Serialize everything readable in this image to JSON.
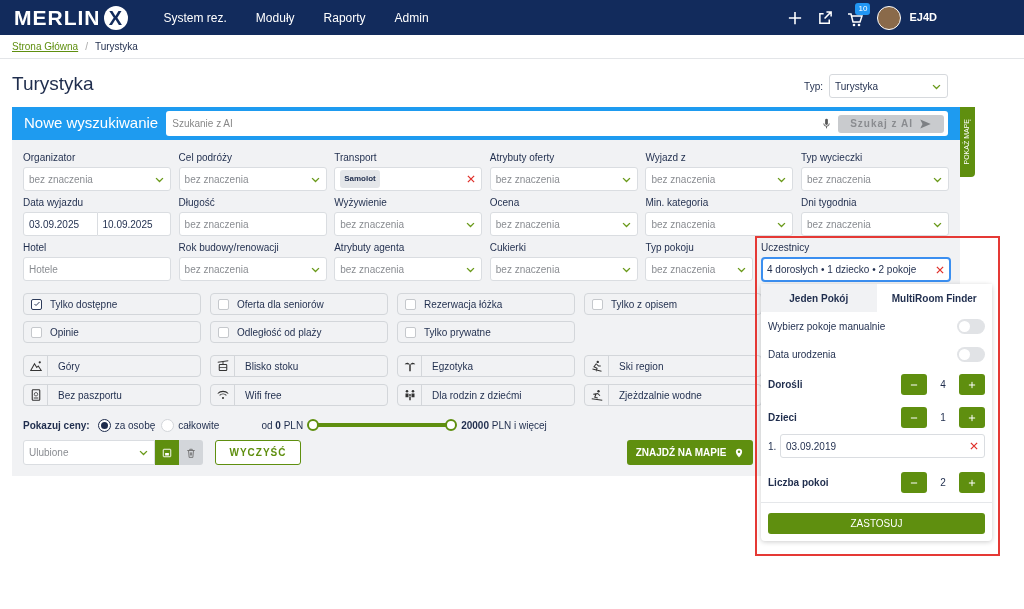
{
  "header": {
    "logo": "MERLIN",
    "logo_mark": "X",
    "nav": [
      {
        "label": "System rez."
      },
      {
        "label": "Moduły"
      },
      {
        "label": "Raporty"
      },
      {
        "label": "Admin"
      }
    ],
    "cart_count": "10",
    "user": "EJ4D"
  },
  "breadcrumb_separator": "/",
  "breadcrumb": [
    {
      "label": "Strona Główna",
      "kind": "link"
    },
    {
      "label": "Turystyka",
      "kind": "current"
    }
  ],
  "title": "Turystyka",
  "type_select": {
    "label": "Typ:",
    "value": "Turystyka"
  },
  "search": {
    "title": "Nowe wyszukiwanie",
    "placeholder": "Szukanie z AI",
    "button": "Szukaj z AI"
  },
  "map_tab": "POKAŻ MAPĘ",
  "fields": [
    {
      "label": "Organizator",
      "kind": "select",
      "placeholder": "bez znaczenia"
    },
    {
      "label": "Cel podróży",
      "kind": "select",
      "placeholder": "bez znaczenia"
    },
    {
      "label": "Transport",
      "kind": "tag",
      "value": "Samolot"
    },
    {
      "label": "Atrybuty oferty",
      "kind": "select",
      "placeholder": "bez znaczenia"
    },
    {
      "label": "Wyjazd z",
      "kind": "select",
      "placeholder": "bez znaczenia"
    },
    {
      "label": "Typ wycieczki",
      "kind": "select",
      "placeholder": "bez znaczenia"
    },
    {
      "label": "Data wyjazdu",
      "kind": "daterange",
      "from": "03.09.2025",
      "to": "10.09.2025"
    },
    {
      "label": "Długość",
      "kind": "text",
      "placeholder": "bez znaczenia"
    },
    {
      "label": "Wyżywienie",
      "kind": "select",
      "placeholder": "bez znaczenia"
    },
    {
      "label": "Ocena",
      "kind": "select",
      "placeholder": "bez znaczenia"
    },
    {
      "label": "Min. kategoria",
      "kind": "select",
      "placeholder": "bez znaczenia"
    },
    {
      "label": "Dni tygodnia",
      "kind": "select",
      "placeholder": "bez znaczenia"
    },
    {
      "label": "Hotel",
      "kind": "text",
      "placeholder": "Hotele"
    },
    {
      "label": "Rok budowy/renowacji",
      "kind": "select",
      "placeholder": "bez znaczenia"
    },
    {
      "label": "Atrybuty agenta",
      "kind": "select",
      "placeholder": "bez znaczenia"
    },
    {
      "label": "Cukierki",
      "kind": "select",
      "placeholder": "bez znaczenia"
    },
    {
      "label": "Typ pokoju",
      "kind": "select",
      "placeholder": "bez znaczenia"
    },
    {
      "label": "Uczestnicy",
      "kind": "participants",
      "value": "4 dorosłych • 1 dziecko • 2 pokoje"
    }
  ],
  "checkboxes": [
    {
      "label": "Tylko dostępne",
      "checked": true
    },
    {
      "label": "Oferta dla seniorów",
      "checked": false
    },
    {
      "label": "Rezerwacja łóżka",
      "checked": false
    },
    {
      "label": "Tylko z opisem",
      "checked": false
    },
    {
      "label": "Opinie",
      "checked": false
    },
    {
      "label": "Odległość od plaży",
      "checked": false
    },
    {
      "label": "Tylko prywatne",
      "checked": false
    }
  ],
  "features": [
    {
      "label": "Góry",
      "kind": "mountain"
    },
    {
      "label": "Blisko stoku",
      "kind": "gondola"
    },
    {
      "label": "Egzotyka",
      "kind": "palm"
    },
    {
      "label": "Ski region",
      "kind": "ski"
    },
    {
      "label": "Bez paszportu",
      "kind": "passport"
    },
    {
      "label": "Wifi free",
      "kind": "wifi"
    },
    {
      "label": "Dla rodzin z dziećmi",
      "kind": "family"
    },
    {
      "label": "Zjeżdzalnie wodne",
      "kind": "slide"
    }
  ],
  "prices": {
    "label": "Pokazuj ceny:",
    "options": [
      {
        "label": "za osobę",
        "selected": true
      },
      {
        "label": "całkowite",
        "selected": false
      }
    ],
    "min": "od **0** PLN",
    "max": "**20000** PLN i więcej",
    "low": {
      "level": 0
    },
    "high": {
      "level": 1
    }
  },
  "favorites": {
    "placeholder": "Ulubione"
  },
  "clear_button": "WYCZYŚĆ",
  "map_button": "ZNAJDŹ NA MAPIE",
  "popup": {
    "tabs": [
      {
        "label": "Jeden Pokój",
        "selected": false
      },
      {
        "label": "MultiRoom Finder",
        "selected": true
      }
    ],
    "toggles": [
      {
        "label": "Wybierz pokoje manualnie",
        "on": false
      },
      {
        "label": "Data urodzenia",
        "on": false
      }
    ],
    "counters": [
      {
        "label": "Dorośli",
        "value": "4"
      },
      {
        "label": "Dzieci",
        "value": "1",
        "dates": [
          {
            "index": "1.",
            "value": "03.09.2019"
          }
        ]
      },
      {
        "label": "Liczba pokoi",
        "value": "2"
      }
    ],
    "apply": "ZASTOSUJ"
  }
}
